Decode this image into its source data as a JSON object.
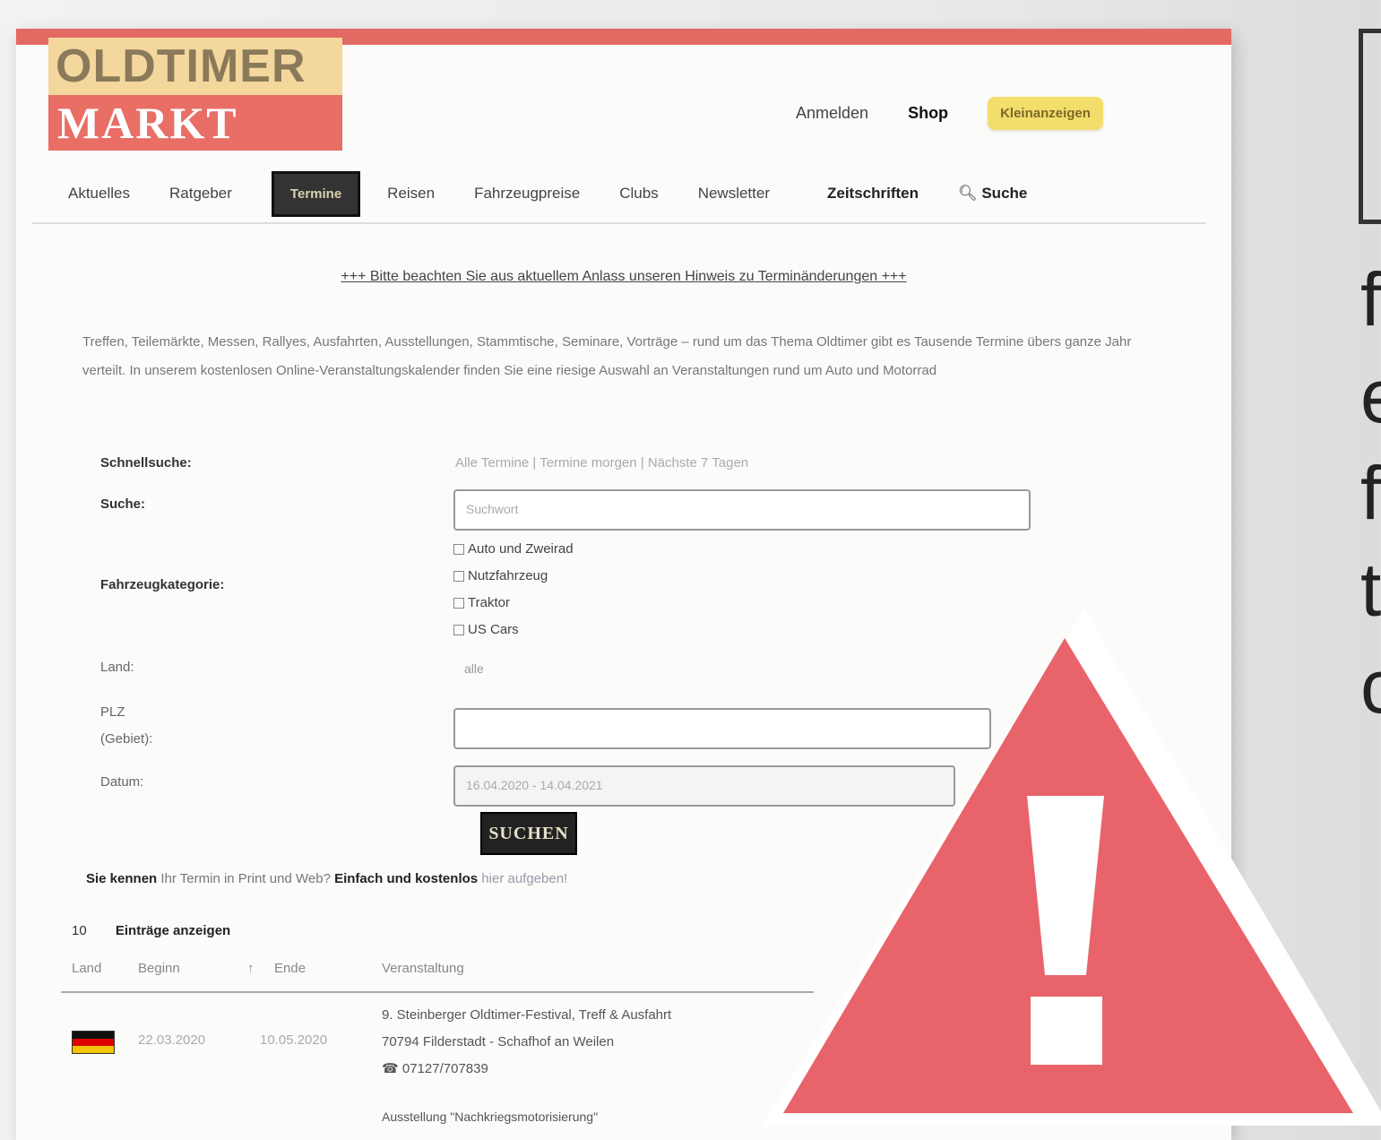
{
  "logo": {
    "line1": "OLDTIMER",
    "line2": "MARKT"
  },
  "top_links": {
    "anmelden": "Anmelden",
    "shop": "Shop",
    "kleinanzeigen": "Kleinanzeigen"
  },
  "nav": {
    "items": [
      "Aktuelles",
      "Ratgeber",
      "Termine",
      "Reisen",
      "Fahrzeugpreise",
      "Clubs",
      "Newsletter"
    ],
    "zeitschriften": "Zeitschriften",
    "suche": "Suche"
  },
  "notice": "+++ Bitte beachten Sie aus aktuellem Anlass unseren Hinweis zu Terminänderungen +++",
  "intro": "Treffen, Teilemärkte, Messen, Rallyes, Ausfahrten, Ausstellungen, Stammtische, Seminare, Vorträge – rund um das Thema Oldtimer gibt es Tausende Termine übers ganze Jahr verteilt. In unserem kostenlosen Online-Veranstaltungskalender finden Sie eine riesige Auswahl an Veranstaltungen rund um Auto und Motorrad",
  "form": {
    "schnellsuche_label": "Schnellsuche:",
    "schnellsuche_hint": "Alle Termine | Termine morgen | Nächste 7 Tagen",
    "suche_label": "Suche:",
    "suche_placeholder": "Suchwort",
    "kategorie_label": "Fahrzeugkategorie:",
    "kategorien": [
      "Auto und Zweirad",
      "Nutzfahrzeug",
      "Traktor",
      "US Cars"
    ],
    "land_label": "Land:",
    "land_value": "alle",
    "plz_label_1": "PLZ",
    "plz_label_2": "(Gebiet):",
    "datum_label": "Datum:",
    "datum_value": "16.04.2020 - 14.04.2021",
    "submit": "SUCHEN"
  },
  "promo": {
    "bold": "Sie kennen",
    "mid": "Ihr Termin in Print und Web?",
    "bold2": "Einfach und kostenlos",
    "link": "hier aufgeben!"
  },
  "perpage": {
    "count": "10",
    "label": "Einträge anzeigen"
  },
  "table": {
    "headers": {
      "land": "Land",
      "beginn": "Beginn",
      "ende": "Ende",
      "veranstaltung": "Veranstaltung"
    },
    "rows": [
      {
        "beginn": "22.03.2020",
        "ende": "10.05.2020",
        "title": "9. Steinberger Oldtimer-Festival, Treff & Ausfahrt",
        "place": "70794 Filderstadt - Schafhof an Weilen",
        "phone": "07127/707839"
      }
    ],
    "footer": "Ausstellung \"Nachkriegsmotorisierung\""
  },
  "right_letters": [
    "f",
    "e",
    "f",
    "t",
    "c"
  ],
  "colors": {
    "accent": "#e36a63",
    "warning": "#e8646a",
    "logo_top": "#f4d79c",
    "kleinanzeigen": "#f3de6b"
  }
}
